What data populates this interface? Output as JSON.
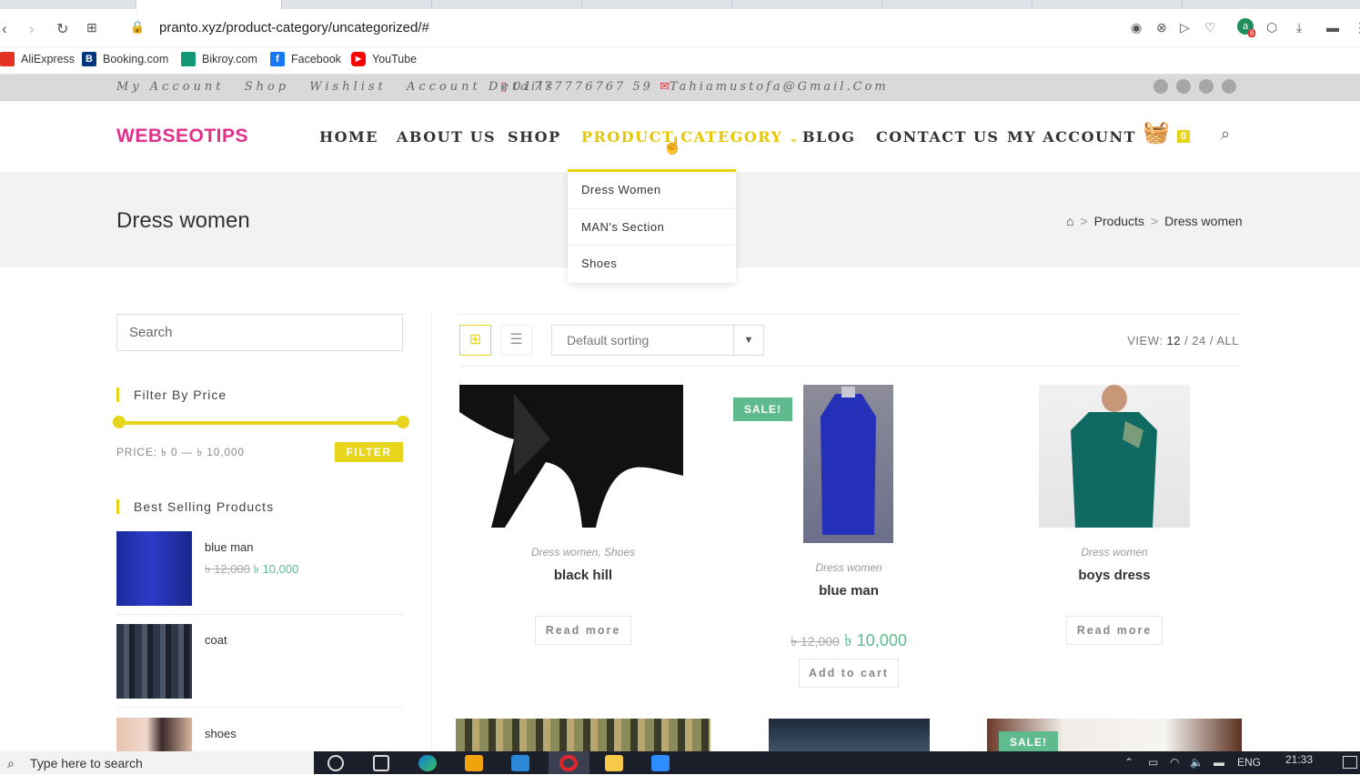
{
  "browser": {
    "url": "pranto.xyz/product-category/uncategorized/#",
    "bookmarks": [
      "AliExpress",
      "Booking.com",
      "Bikroy.com",
      "Facebook",
      "YouTube"
    ],
    "extension_badge": "8"
  },
  "topbar": {
    "links": [
      "My Account",
      "Shop",
      "Wishlist",
      "Account Details"
    ],
    "phone": "01777776767 59",
    "email": "Tahiamustofa@Gmail.Com"
  },
  "header": {
    "logo": "WEBSEOTIPS",
    "menu": [
      "HOME",
      "ABOUT US",
      "SHOP",
      "PRODUCT CATEGORY",
      "BLOG",
      "CONTACT US",
      "MY ACCOUNT"
    ],
    "cart_count": "0",
    "dropdown": [
      "Dress Women",
      "MAN's Section",
      "Shoes"
    ]
  },
  "page": {
    "title": "Dress women",
    "breadcrumb": [
      "Products",
      "Dress women"
    ]
  },
  "sidebar": {
    "search_placeholder": "Search",
    "filter_title": "Filter By Price",
    "price_label": "PRICE: ৳ 0 — ৳ 10,000",
    "filter_button": "FILTER",
    "best_title": "Best Selling Products",
    "best": [
      {
        "name": "blue man",
        "old_price": "৳ 12,000",
        "new_price": "৳ 10,000"
      },
      {
        "name": "coat"
      },
      {
        "name": "shoes"
      }
    ]
  },
  "toolbar": {
    "sort": "Default sorting",
    "view_label": "VIEW:",
    "view_current": "12",
    "view_options": "/ 24 / ALL"
  },
  "products": [
    {
      "category": "Dress women, Shoes",
      "title": "black hill",
      "button": "Read more"
    },
    {
      "category": "Dress women",
      "title": "blue man",
      "old_price": "৳ 12,000",
      "new_price": "৳ 10,000",
      "button": "Add to cart",
      "badge": "SALE!"
    },
    {
      "category": "Dress women",
      "title": "boys dress",
      "button": "Read more"
    }
  ],
  "bottom_badge": "SALE!",
  "taskbar": {
    "search": "Type here to search",
    "lang": "ENG",
    "time": "21:33"
  },
  "colors": {
    "accent": "#e6d51a",
    "brand": "#e0308a",
    "sale": "#5fbb8d"
  }
}
